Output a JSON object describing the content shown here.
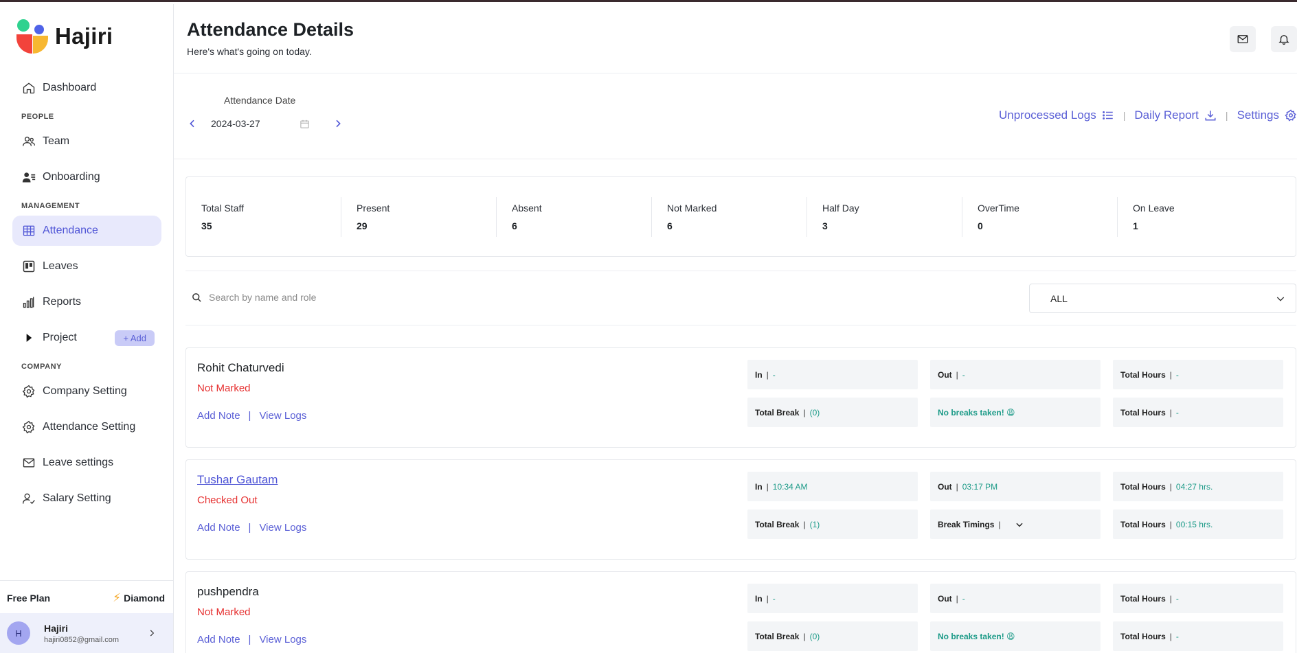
{
  "brand": {
    "name": "Hajiri"
  },
  "sidebar": {
    "dashboard": "Dashboard",
    "section_people": "PEOPLE",
    "team": "Team",
    "onboarding": "Onboarding",
    "section_management": "MANAGEMENT",
    "attendance": "Attendance",
    "leaves": "Leaves",
    "reports": "Reports",
    "project": "Project",
    "add_label": "+ Add",
    "section_company": "COMPANY",
    "company_setting": "Company Setting",
    "attendance_setting": "Attendance Setting",
    "leave_settings": "Leave settings",
    "salary_setting": "Salary Setting"
  },
  "plan": {
    "name": "Free Plan",
    "tier": "Diamond"
  },
  "user": {
    "initial": "H",
    "name": "Hajiri",
    "email": "hajiri0852@gmail.com"
  },
  "header": {
    "title": "Attendance Details",
    "subtitle": "Here's what's going on today."
  },
  "datebar": {
    "label": "Attendance Date",
    "date": "2024-03-27",
    "unprocessed_logs": "Unprocessed Logs",
    "daily_report": "Daily Report",
    "settings": "Settings",
    "separator": "|"
  },
  "stats": [
    {
      "label": "Total Staff",
      "value": "35"
    },
    {
      "label": "Present",
      "value": "29"
    },
    {
      "label": "Absent",
      "value": "6"
    },
    {
      "label": "Not Marked",
      "value": "6"
    },
    {
      "label": "Half Day",
      "value": "3"
    },
    {
      "label": "OverTime",
      "value": "0"
    },
    {
      "label": "On Leave",
      "value": "1"
    }
  ],
  "filter": {
    "search_placeholder": "Search by name and role",
    "selected": "ALL"
  },
  "labels": {
    "in": "In",
    "out": "Out",
    "total_hours": "Total Hours",
    "total_break": "Total Break",
    "break_timings": "Break Timings",
    "add_note": "Add Note",
    "view_logs": "View Logs",
    "pipe": "|"
  },
  "employees": [
    {
      "name": "Rohit Chaturvedi",
      "status": "Not Marked",
      "in": "-",
      "out": "-",
      "total_hours": "-",
      "total_break": "(0)",
      "break_info": "No breaks taken! 😩",
      "break_hours": "-"
    },
    {
      "name": "Tushar Gautam",
      "status": "Checked Out",
      "in": "10:34 AM",
      "out": "03:17 PM",
      "total_hours": "04:27 hrs.",
      "total_break": "(1)",
      "break_info": "",
      "break_hours": "00:15 hrs."
    },
    {
      "name": "pushpendra",
      "status": "Not Marked",
      "in": "-",
      "out": "-",
      "total_hours": "-",
      "total_break": "(0)",
      "break_info": "No breaks taken! 😩",
      "break_hours": "-"
    }
  ],
  "colors": {
    "accent": "#5a5fd6",
    "danger": "#e63030",
    "success": "#1b9a87",
    "active_bg": "#e8e9fc"
  }
}
